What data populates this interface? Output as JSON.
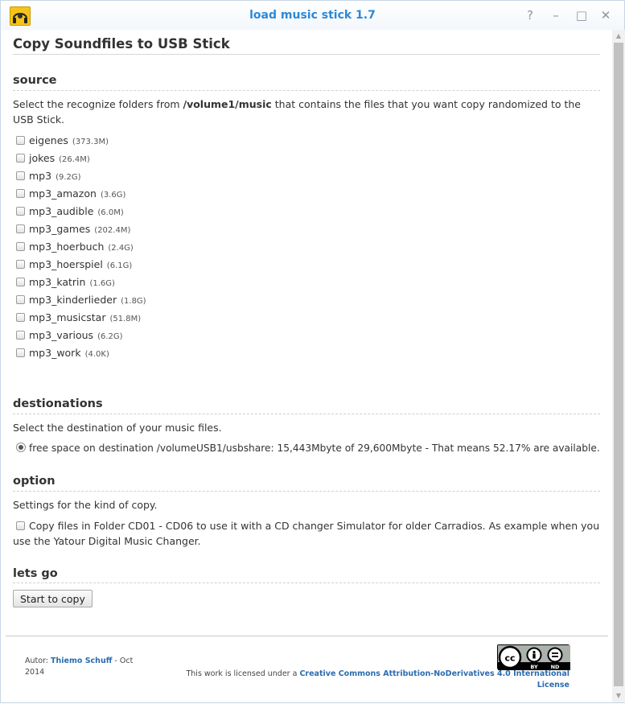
{
  "window": {
    "title": "load music stick 1.7",
    "buttons": {
      "help": "?",
      "minimize": "–",
      "maximize": "□",
      "close": "✕"
    }
  },
  "page": {
    "heading": "Copy Soundfiles to USB Stick"
  },
  "source": {
    "heading": "source",
    "description_pre": "Select the recognize folders from ",
    "path": "/volume1/music",
    "description_post": " that contains the files that you want copy randomized to the USB Stick.",
    "folders": [
      {
        "name": "eigenes",
        "size": "(373.3M)"
      },
      {
        "name": "jokes",
        "size": "(26.4M)"
      },
      {
        "name": "mp3",
        "size": "(9.2G)"
      },
      {
        "name": "mp3_amazon",
        "size": "(3.6G)"
      },
      {
        "name": "mp3_audible",
        "size": "(6.0M)"
      },
      {
        "name": "mp3_games",
        "size": "(202.4M)"
      },
      {
        "name": "mp3_hoerbuch",
        "size": "(2.4G)"
      },
      {
        "name": "mp3_hoerspiel",
        "size": "(6.1G)"
      },
      {
        "name": "mp3_katrin",
        "size": "(1.6G)"
      },
      {
        "name": "mp3_kinderlieder",
        "size": "(1.8G)"
      },
      {
        "name": "mp3_musicstar",
        "size": "(51.8M)"
      },
      {
        "name": "mp3_various",
        "size": "(6.2G)"
      },
      {
        "name": "mp3_work",
        "size": "(4.0K)"
      }
    ]
  },
  "destinations": {
    "heading": "destionations",
    "description": "Select the destination of your music files.",
    "option_label": "free space on destination /volumeUSB1/usbshare: 15,443Mbyte of 29,600Mbyte - That means 52.17% are available."
  },
  "option": {
    "heading": "option",
    "description": "Settings for the kind of copy.",
    "checkbox_label": "Copy files in Folder CD01 - CD06 to use it with a CD changer Simulator for older Carradios. As example when you use the Yatour Digital Music Changer."
  },
  "letsgo": {
    "heading": "lets go",
    "button_label": "Start to copy"
  },
  "footer": {
    "author_prefix": "Autor: ",
    "author_name": "Thiemo Schuff",
    "author_suffix": " - Oct 2014",
    "license_prefix": "This work is licensed under a ",
    "license_link": "Creative Commons Attribution-NoDerivatives 4.0 International License",
    "badge_text": "cc by nd"
  }
}
